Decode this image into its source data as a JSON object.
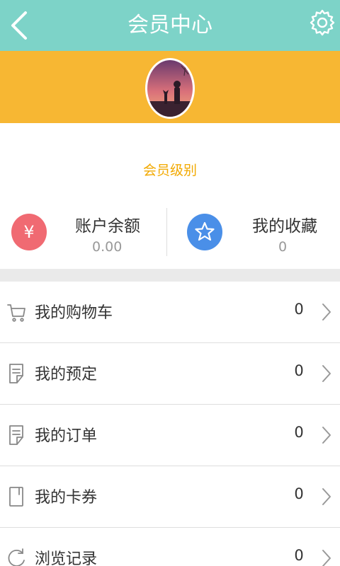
{
  "header": {
    "title": "会员中心",
    "back_icon": "chevron-left-icon",
    "settings_icon": "gear-icon",
    "bg_color": "#7dd3c8"
  },
  "profile": {
    "banner_color": "#f7b733",
    "level_label": "会员级别"
  },
  "stats": {
    "balance": {
      "label": "账户余额",
      "value": "0.00",
      "icon": "yuan-icon",
      "icon_glyph": "¥",
      "color": "#f06a72"
    },
    "favorites": {
      "label": "我的收藏",
      "value": "0",
      "icon": "star-icon",
      "color": "#4a8fe8"
    }
  },
  "menu": [
    {
      "label": "我的购物车",
      "count": "0",
      "icon": "cart-icon"
    },
    {
      "label": "我的预定",
      "count": "0",
      "icon": "document-icon"
    },
    {
      "label": "我的订单",
      "count": "0",
      "icon": "document-icon"
    },
    {
      "label": "我的卡券",
      "count": "0",
      "icon": "card-icon"
    },
    {
      "label": "浏览记录",
      "count": "0",
      "icon": "refresh-icon"
    }
  ]
}
